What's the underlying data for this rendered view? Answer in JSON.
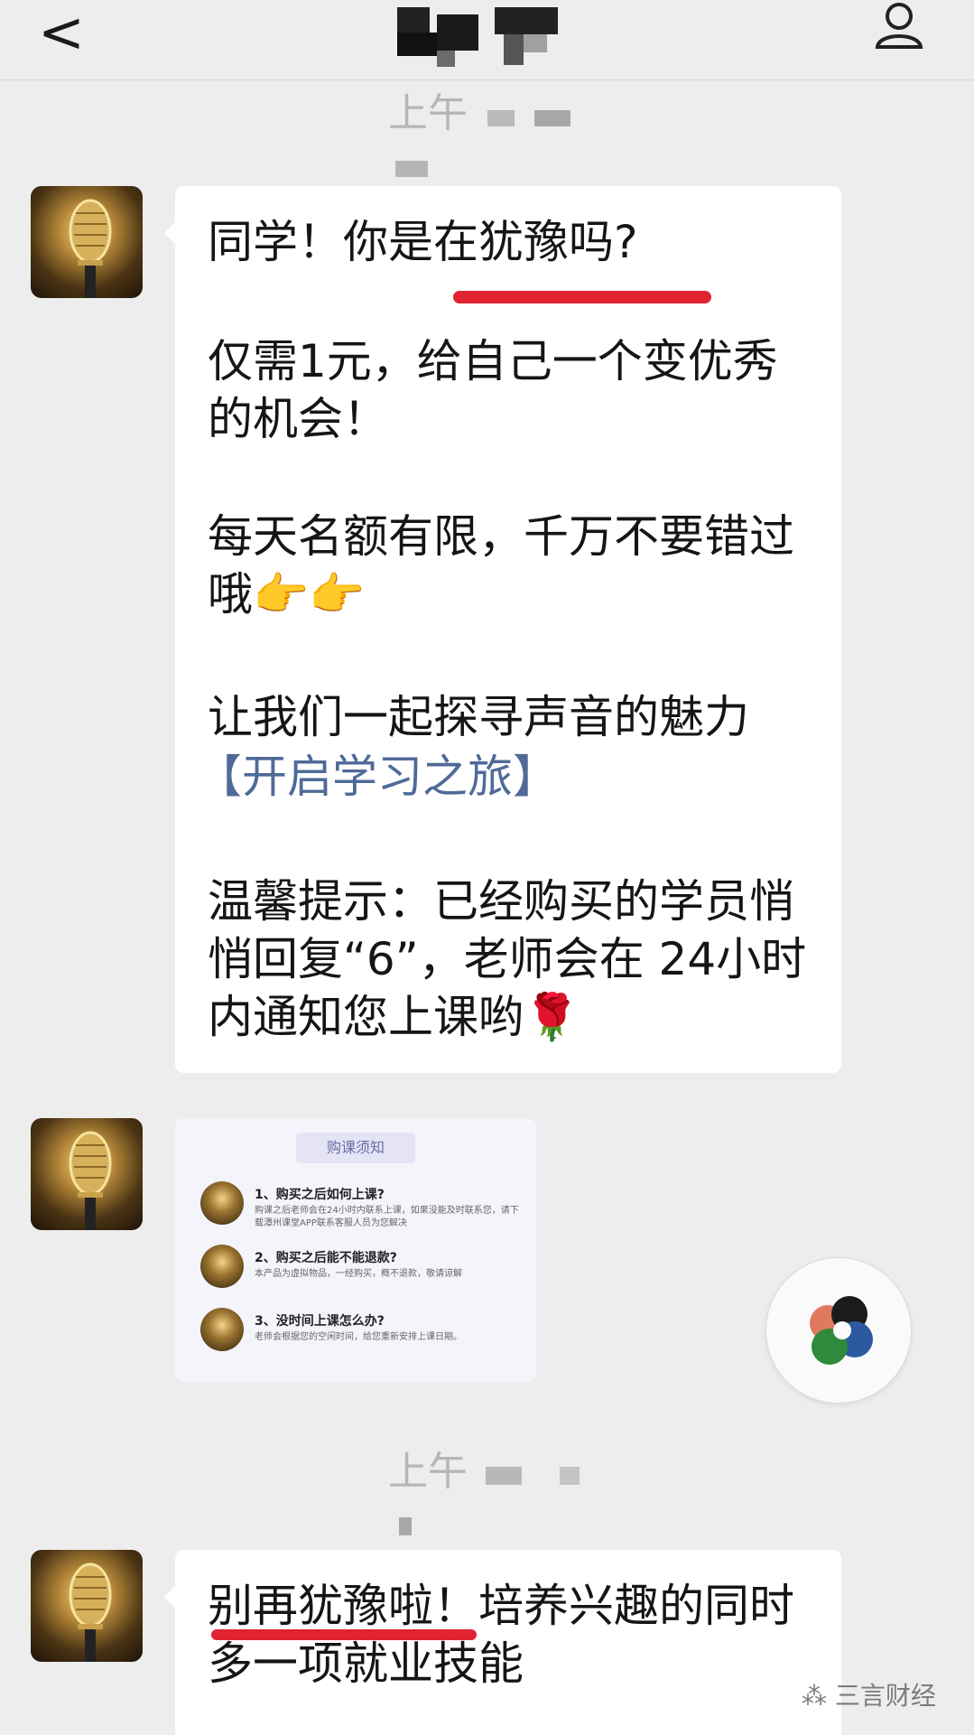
{
  "header": {
    "back_glyph": "<",
    "title_redacted": true
  },
  "messages": [
    {
      "type": "timestamp",
      "text": "上午"
    },
    {
      "type": "text",
      "paragraphs": [
        "同学！你是在犹豫吗?",
        "仅需1元，给自己一个变优秀的机会！",
        "每天名额有限，千万不要错过哦👉👉",
        "让我们一起探寻声音的魅力",
        "【开启学习之旅】",
        "温馨提示：已经购买的学员悄悄回复“6”，老师会在 24小时内通知您上课哟🌹"
      ]
    },
    {
      "type": "image",
      "card": {
        "title": "购课须知",
        "items": [
          {
            "q": "1、购买之后如何上课?",
            "a": "购课之后老师会在24小时内联系上课，如果没能及时联系您，请下载潭州课堂APP联系客服人员为您解决"
          },
          {
            "q": "2、购买之后能不能退款?",
            "a": "本产品为虚拟物品，一经购买，概不退款，敬请谅解"
          },
          {
            "q": "3、没时间上课怎么办?",
            "a": "老师会根据您的空闲时间，给您重新安排上课日期。"
          }
        ]
      }
    },
    {
      "type": "timestamp",
      "text": "上午"
    },
    {
      "type": "text",
      "paragraphs": [
        "别再犹豫啦！培养兴趣的同时多一项就业技能"
      ]
    }
  ],
  "watermark": {
    "text": "三言财经"
  },
  "colors": {
    "background": "#ededed",
    "bubble": "#ffffff",
    "annotation_red": "#e0232f",
    "link_blue": "#4f6a98"
  }
}
